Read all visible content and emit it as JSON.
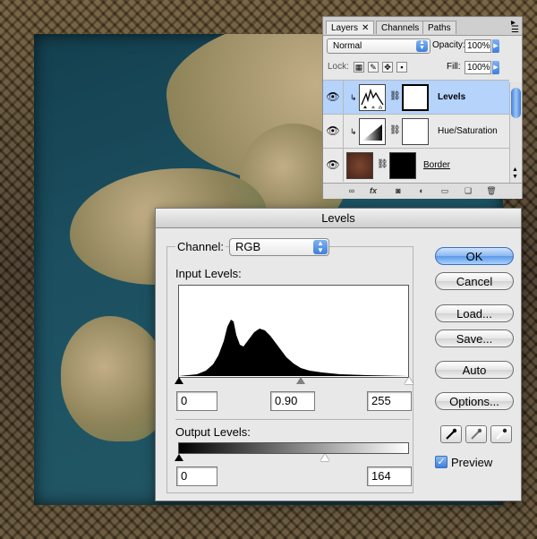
{
  "layers_panel": {
    "tabs": [
      {
        "label": "Layers",
        "active": true
      },
      {
        "label": "Channels",
        "active": false
      },
      {
        "label": "Paths",
        "active": false
      }
    ],
    "blend_mode": "Normal",
    "opacity_label": "Opacity:",
    "opacity_value": "100%",
    "lock_label": "Lock:",
    "fill_label": "Fill:",
    "fill_value": "100%",
    "layers": [
      {
        "name": "Levels",
        "selected": true
      },
      {
        "name": "Hue/Saturation",
        "selected": false
      },
      {
        "name": "Border",
        "selected": false
      }
    ],
    "bottom_icons": [
      "link-icon",
      "fx-icon",
      "mask-icon",
      "adjustment-icon",
      "group-icon",
      "new-layer-icon",
      "trash-icon"
    ]
  },
  "levels_dialog": {
    "title": "Levels",
    "channel_label": "Channel:",
    "channel_value": "RGB",
    "input_levels_label": "Input Levels:",
    "input_black": "0",
    "input_gamma": "0.90",
    "input_white": "255",
    "output_levels_label": "Output Levels:",
    "output_black": "0",
    "output_white": "164",
    "buttons": {
      "ok": "OK",
      "cancel": "Cancel",
      "load": "Load...",
      "save": "Save...",
      "auto": "Auto",
      "options": "Options..."
    },
    "preview_label": "Preview",
    "preview_checked": true
  },
  "colors": {
    "selection": "#b5d3fb",
    "aqua_blue": "#3f7fdc"
  }
}
